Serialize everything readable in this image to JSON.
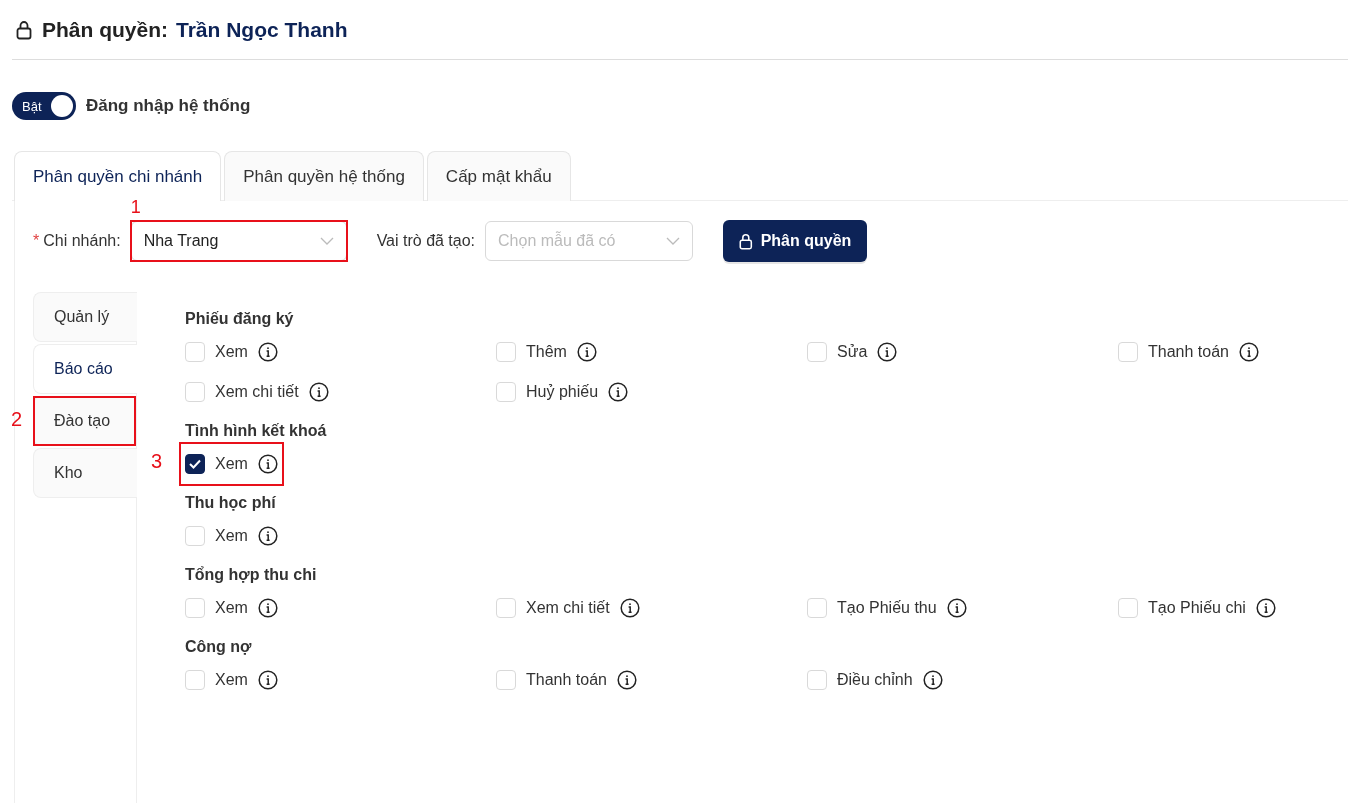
{
  "header": {
    "label": "Phân quyền:",
    "name": "Trần Ngọc Thanh"
  },
  "login_toggle": {
    "on": true,
    "switch_text": "Bật",
    "label": "Đăng nhập hệ thống"
  },
  "tabs": [
    {
      "label": "Phân quyền chi nhánh",
      "selected": true
    },
    {
      "label": "Phân quyền hệ thống",
      "selected": false
    },
    {
      "label": "Cấp mật khẩu",
      "selected": false
    }
  ],
  "filters": {
    "branch": {
      "label": "Chi nhánh:",
      "required_mark": "*",
      "value": "Nha Trang",
      "annotation": "1"
    },
    "role": {
      "label": "Vai trò đã tạo:",
      "placeholder": "Chọn mẫu đã có"
    },
    "button": "Phân quyền"
  },
  "side_tabs": [
    {
      "label": "Quản lý",
      "selected": false
    },
    {
      "label": "Báo cáo",
      "selected": true
    },
    {
      "label": "Đào tạo",
      "selected": false,
      "annotation": "2"
    },
    {
      "label": "Kho",
      "selected": false
    }
  ],
  "groups": [
    {
      "title": "Phiếu đăng ký",
      "permissions": [
        {
          "label": "Xem",
          "checked": false
        },
        {
          "label": "Thêm",
          "checked": false
        },
        {
          "label": "Sửa",
          "checked": false
        },
        {
          "label": "Thanh toán",
          "checked": false
        },
        {
          "label": "Xem chi tiết",
          "checked": false
        },
        {
          "label": "Huỷ phiếu",
          "checked": false
        }
      ]
    },
    {
      "title": "Tình hình kết khoá",
      "permissions": [
        {
          "label": "Xem",
          "checked": true,
          "annotation": "3"
        }
      ]
    },
    {
      "title": "Thu học phí",
      "permissions": [
        {
          "label": "Xem",
          "checked": false
        }
      ]
    },
    {
      "title": "Tổng hợp thu chi",
      "permissions": [
        {
          "label": "Xem",
          "checked": false
        },
        {
          "label": "Xem chi tiết",
          "checked": false
        },
        {
          "label": "Tạo Phiếu thu",
          "checked": false
        },
        {
          "label": "Tạo Phiếu chi",
          "checked": false
        }
      ]
    },
    {
      "title": "Công nợ",
      "permissions": [
        {
          "label": "Xem",
          "checked": false
        },
        {
          "label": "Thanh toán",
          "checked": false
        },
        {
          "label": "Điều chỉnh",
          "checked": false
        }
      ]
    }
  ]
}
